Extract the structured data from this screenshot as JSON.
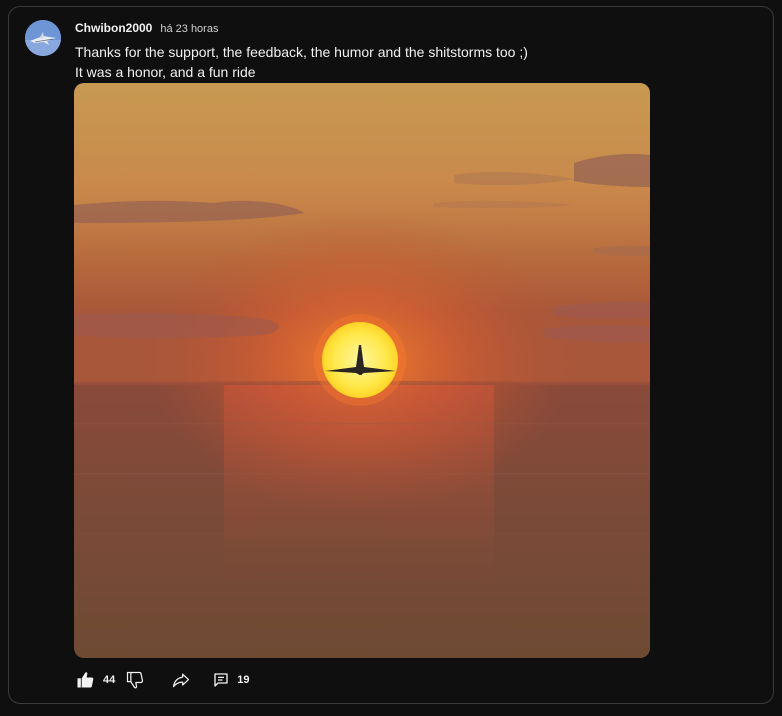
{
  "post": {
    "author": "Chwibon2000",
    "timestamp": "há 23 horas",
    "text_line_1": "Thanks for the support, the feedback, the humor and the shitstorms too ;)",
    "text_line_2": "It was a honor, and a fun ride"
  },
  "actions": {
    "like_count": "44",
    "comment_count": "19"
  },
  "colors": {
    "background": "#0f0f0f",
    "border": "#3a3a3a",
    "text": "#f1f1f1",
    "secondary_text": "#cfcfcf"
  },
  "icons": {
    "avatar": "jet-aircraft-avatar",
    "like": "thumbs-up-icon",
    "dislike": "thumbs-down-icon",
    "share": "share-arrow-icon",
    "comment": "comment-icon"
  }
}
